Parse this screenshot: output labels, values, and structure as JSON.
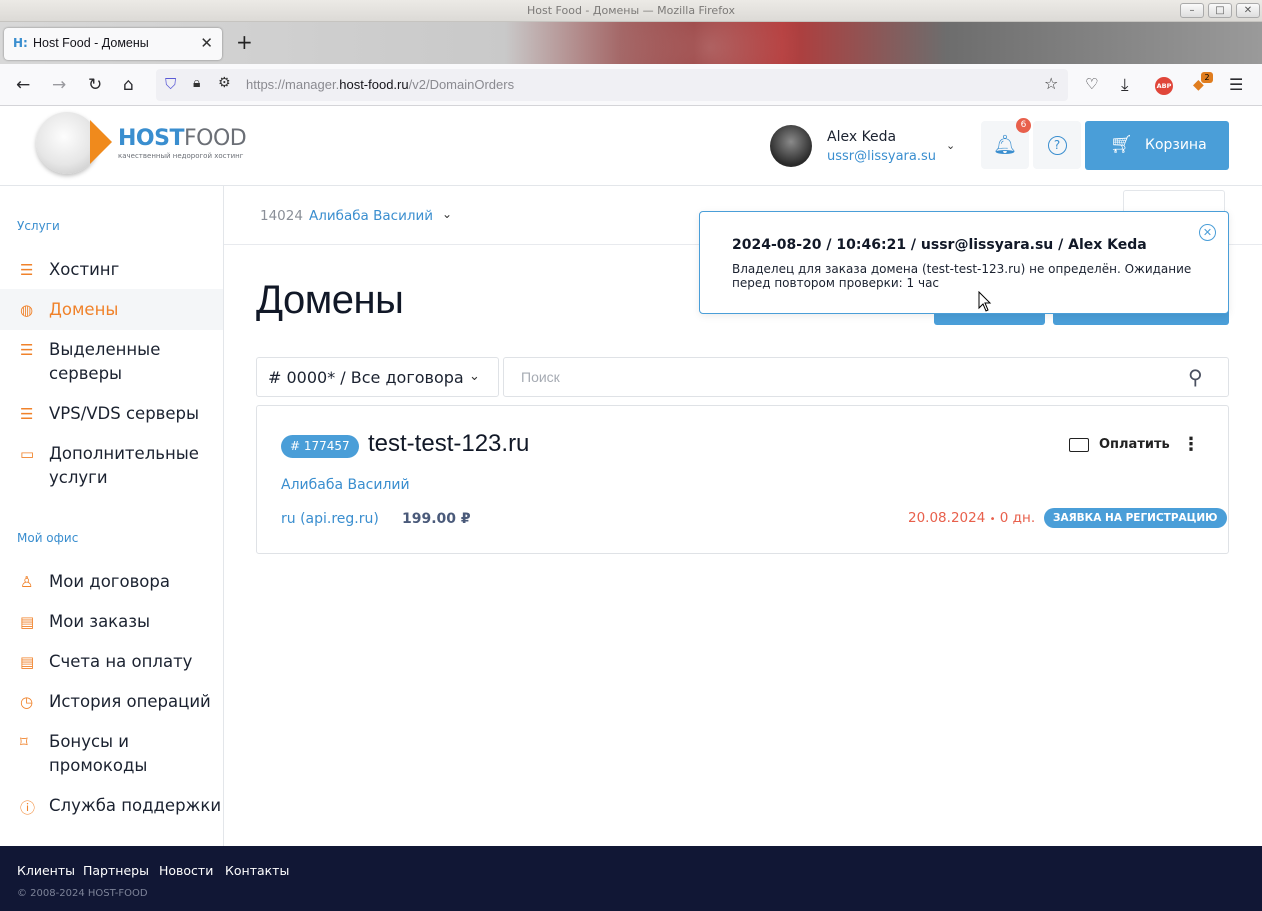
{
  "browser": {
    "window_title": "Host Food - Домены — Mozilla Firefox",
    "tab_title": "Host Food - Домены",
    "url_prefix": "https://manager.",
    "url_domain": "host-food.ru",
    "url_path": "/v2/DomainOrders",
    "extension_badge": "2",
    "abp_label": "ABP"
  },
  "header": {
    "logo_primary": "HOST",
    "logo_secondary": "FOOD",
    "logo_tagline": "качественный недорогой хостинг",
    "user_name": "Alex Keda",
    "user_email": "ussr@lissyara.su",
    "notifications_count": "6",
    "cart_label": "Корзина"
  },
  "sidebar": {
    "services_title": "Услуги",
    "services": [
      {
        "label": "Хостинг",
        "icon": "stack-icon"
      },
      {
        "label": "Домены",
        "icon": "globe-icon",
        "active": true
      },
      {
        "label": "Выделенные серверы",
        "icon": "server-icon"
      },
      {
        "label": "VPS/VDS серверы",
        "icon": "vps-icon"
      },
      {
        "label": "Дополнительные услуги",
        "icon": "extras-icon"
      }
    ],
    "office_title": "Мой офис",
    "office": [
      {
        "label": "Мои договора",
        "icon": "user-icon"
      },
      {
        "label": "Мои заказы",
        "icon": "orders-icon"
      },
      {
        "label": "Счета на оплату",
        "icon": "invoice-icon"
      },
      {
        "label": "История операций",
        "icon": "history-icon"
      },
      {
        "label": "Бонусы и промокоды",
        "icon": "tag-icon"
      },
      {
        "label": "Служба поддержки",
        "icon": "help-icon"
      }
    ]
  },
  "main": {
    "contract_number": "14024",
    "contract_name": "Алибаба Василий",
    "page_title": "Домены",
    "filter_label": "# 0000* / Все договора",
    "search_placeholder": "Поиск",
    "order": {
      "id": "# 177457",
      "domain": "test-test-123.ru",
      "pay_label": "Оплатить",
      "owner": "Алибаба Василий",
      "zone": "ru (api.reg.ru)",
      "price": "199.00 ₽",
      "date": "20.08.2024",
      "days": "0 дн.",
      "status": "ЗАЯВКА НА РЕГИСТРАЦИЮ"
    }
  },
  "notification": {
    "header": "2024-08-20 / 10:46:21 / ussr@lissyara.su / Alex Keda",
    "body": "Владелец для заказа домена (test-test-123.ru) не определён. Ожидание перед повтором проверки: 1 час"
  },
  "footer": {
    "links": [
      "Клиенты",
      "Партнеры",
      "Новости",
      "Контакты"
    ],
    "copyright": "© 2008-2024 HOST-FOOD"
  },
  "colors": {
    "accent_blue": "#4a9ed8",
    "accent_orange": "#f0822a",
    "danger_red": "#e8604c",
    "footer_bg": "#111735"
  }
}
